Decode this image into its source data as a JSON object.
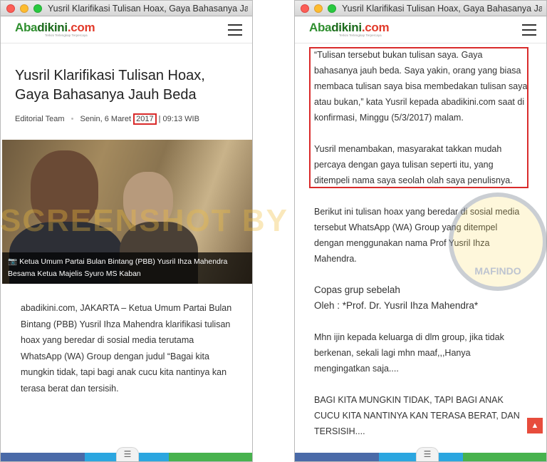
{
  "window_title": "Yusril Klarifikasi Tulisan Hoax, Gaya Bahasanya Jauh Be...",
  "logo": {
    "part1": "Aba",
    "part2": "dikini",
    "part3": ".com",
    "tagline": "Terkini Terlengkap Terpercaya"
  },
  "article": {
    "title": "Yusril Klarifikasi Tulisan Hoax, Gaya Bahasanya Jauh Beda",
    "author": "Editorial Team",
    "date_prefix": "Senin, 6 Maret",
    "date_year": "2017",
    "time": "| 09:13 WIB",
    "caption": "Ketua Umum Partai Bulan Bintang (PBB) Yusril Ihza Mahendra Besama Ketua Majelis Syuro MS Kaban",
    "lead": "abadikini.com, JAKARTA – Ketua Umum Partai Bulan Bintang (PBB) Yusril Ihza Mahendra klarifikasi tulisan hoax yang beredar di sosial media terutama WhatsApp (WA) Group dengan judul “Bagai kita mungkin tidak, tapi bagi anak cucu kita nantinya kan terasa berat dan tersisih."
  },
  "right_body": {
    "p1": "“Tulisan tersebut bukan tulisan saya. Gaya bahasanya jauh beda. Saya yakin, orang yang biasa membaca tulisan saya bisa membedakan tulisan saya atau bukan,” kata Yusril kepada abadikini.com saat di konfirmasi, Minggu (5/3/2017) malam.",
    "p2": "Yusril menambakan, masyarakat takkan mudah percaya dengan gaya tulisan seperti itu, yang ditempeli nama saya seolah olah saya penulisnya.",
    "p3": "Berikut ini tulisan hoax yang beredar di sosial media tersebut WhatsApp (WA) Group yang ditempel dengan menggunakan nama Prof Yusril Ihza Mahendra.",
    "p4_line1": "Copas grup sebelah",
    "p4_line2": "Oleh : *Prof. Dr. Yusril Ihza Mahendra*",
    "p5": "Mhn ijin kepada keluarga di dlm group, jika tidak berkenan, sekali lagi mhn maaf,,,Hanya mengingatkan saja....",
    "p6": "BAGI KITA MUNGKIN TIDAK, TAPI BAGI ANAK CUCU KITA NANTINYA KAN TERASA BERAT, DAN TERSISIH...."
  },
  "watermark": "SCREENSHOT BY",
  "stamp": "MAFINDO",
  "colors": {
    "highlight": "#d92b2b",
    "facebook": "#4a6aa8",
    "twitter": "#2ba6e0",
    "whatsapp": "#48b24e",
    "scroll_top": "#e74c3c"
  }
}
